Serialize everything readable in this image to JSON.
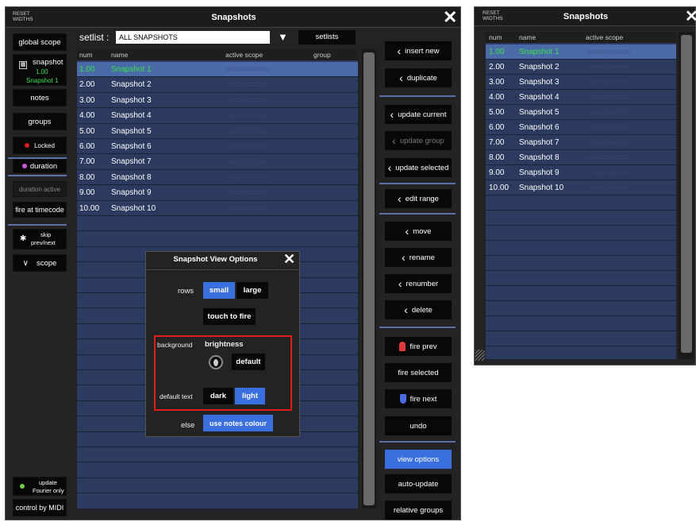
{
  "main": {
    "reset_label": "RESET WIDTHS",
    "title": "Snapshots",
    "setlist_label": "setlist :",
    "setlist_value": "ALL SNAPSHOTS",
    "setlists_button": "setlists",
    "columns": {
      "num": "num",
      "name": "name",
      "scope": "active scope",
      "group": "group"
    },
    "rows": [
      {
        "num": "1.00",
        "name": "Snapshot 1",
        "selected": true
      },
      {
        "num": "2.00",
        "name": "Snapshot 2"
      },
      {
        "num": "3.00",
        "name": "Snapshot 3"
      },
      {
        "num": "4.00",
        "name": "Snapshot 4"
      },
      {
        "num": "5.00",
        "name": "Snapshot 5"
      },
      {
        "num": "6.00",
        "name": "Snapshot 6"
      },
      {
        "num": "7.00",
        "name": "Snapshot 7"
      },
      {
        "num": "8.00",
        "name": "Snapshot 8"
      },
      {
        "num": "9.00",
        "name": "Snapshot 9"
      },
      {
        "num": "10.00",
        "name": "Snapshot 10"
      }
    ],
    "scope_dots": "○○○○○○○○○○○"
  },
  "left": {
    "global_scope": "global scope",
    "snapshot_label": "snapshot",
    "snapshot_num": "1.00",
    "snapshot_name": "Snapshot 1",
    "notes": "notes",
    "groups": "groups",
    "locked": "Locked",
    "duration": "duration",
    "duration_active": "duration active",
    "fire_at_timecode": "fire at timecode",
    "skip": "skip",
    "skip2": "prev/next",
    "scope": "scope",
    "update": "update",
    "update2": "Fourier only",
    "control_midi": "control by MIDI"
  },
  "right": {
    "insert_new": "insert new",
    "duplicate": "duplicate",
    "update_current": "update current",
    "update_group": "update group",
    "update_selected": "update selected",
    "edit_range": "edit range",
    "move": "move",
    "rename": "rename",
    "renumber": "renumber",
    "delete": "delete",
    "fire_prev": "fire prev",
    "fire_selected": "fire selected",
    "fire_next": "fire next",
    "undo": "undo",
    "view_options": "view options",
    "auto_update": "auto-update",
    "relative_groups": "relative groups"
  },
  "dialog": {
    "title": "Snapshot View Options",
    "rows_label": "rows",
    "small": "small",
    "large": "large",
    "touch_to_fire": "touch to fire",
    "background_label": "background",
    "brightness_label": "brightness",
    "default_btn": "default",
    "default_text_label": "default text",
    "dark": "dark",
    "light": "light",
    "else_label": "else",
    "use_notes_colour": "use notes colour"
  },
  "small_window": {
    "reset_label": "RESET WIDTHS",
    "title": "Snapshots",
    "columns": {
      "num": "num",
      "name": "name",
      "scope": "active scope"
    }
  },
  "colors": {
    "accent_blue": "#3a6fe0",
    "selected_green": "#39e04a",
    "row_bg": "#2b3a5e",
    "highlight_red": "#e21b1b"
  }
}
